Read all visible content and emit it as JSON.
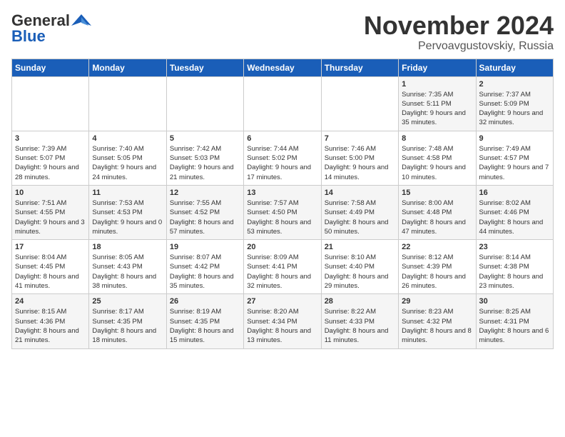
{
  "logo": {
    "general": "General",
    "blue": "Blue"
  },
  "title": "November 2024",
  "location": "Pervoavgustovskiy, Russia",
  "days_header": [
    "Sunday",
    "Monday",
    "Tuesday",
    "Wednesday",
    "Thursday",
    "Friday",
    "Saturday"
  ],
  "weeks": [
    [
      {
        "day": "",
        "detail": ""
      },
      {
        "day": "",
        "detail": ""
      },
      {
        "day": "",
        "detail": ""
      },
      {
        "day": "",
        "detail": ""
      },
      {
        "day": "",
        "detail": ""
      },
      {
        "day": "1",
        "detail": "Sunrise: 7:35 AM\nSunset: 5:11 PM\nDaylight: 9 hours and 35 minutes."
      },
      {
        "day": "2",
        "detail": "Sunrise: 7:37 AM\nSunset: 5:09 PM\nDaylight: 9 hours and 32 minutes."
      }
    ],
    [
      {
        "day": "3",
        "detail": "Sunrise: 7:39 AM\nSunset: 5:07 PM\nDaylight: 9 hours and 28 minutes."
      },
      {
        "day": "4",
        "detail": "Sunrise: 7:40 AM\nSunset: 5:05 PM\nDaylight: 9 hours and 24 minutes."
      },
      {
        "day": "5",
        "detail": "Sunrise: 7:42 AM\nSunset: 5:03 PM\nDaylight: 9 hours and 21 minutes."
      },
      {
        "day": "6",
        "detail": "Sunrise: 7:44 AM\nSunset: 5:02 PM\nDaylight: 9 hours and 17 minutes."
      },
      {
        "day": "7",
        "detail": "Sunrise: 7:46 AM\nSunset: 5:00 PM\nDaylight: 9 hours and 14 minutes."
      },
      {
        "day": "8",
        "detail": "Sunrise: 7:48 AM\nSunset: 4:58 PM\nDaylight: 9 hours and 10 minutes."
      },
      {
        "day": "9",
        "detail": "Sunrise: 7:49 AM\nSunset: 4:57 PM\nDaylight: 9 hours and 7 minutes."
      }
    ],
    [
      {
        "day": "10",
        "detail": "Sunrise: 7:51 AM\nSunset: 4:55 PM\nDaylight: 9 hours and 3 minutes."
      },
      {
        "day": "11",
        "detail": "Sunrise: 7:53 AM\nSunset: 4:53 PM\nDaylight: 9 hours and 0 minutes."
      },
      {
        "day": "12",
        "detail": "Sunrise: 7:55 AM\nSunset: 4:52 PM\nDaylight: 8 hours and 57 minutes."
      },
      {
        "day": "13",
        "detail": "Sunrise: 7:57 AM\nSunset: 4:50 PM\nDaylight: 8 hours and 53 minutes."
      },
      {
        "day": "14",
        "detail": "Sunrise: 7:58 AM\nSunset: 4:49 PM\nDaylight: 8 hours and 50 minutes."
      },
      {
        "day": "15",
        "detail": "Sunrise: 8:00 AM\nSunset: 4:48 PM\nDaylight: 8 hours and 47 minutes."
      },
      {
        "day": "16",
        "detail": "Sunrise: 8:02 AM\nSunset: 4:46 PM\nDaylight: 8 hours and 44 minutes."
      }
    ],
    [
      {
        "day": "17",
        "detail": "Sunrise: 8:04 AM\nSunset: 4:45 PM\nDaylight: 8 hours and 41 minutes."
      },
      {
        "day": "18",
        "detail": "Sunrise: 8:05 AM\nSunset: 4:43 PM\nDaylight: 8 hours and 38 minutes."
      },
      {
        "day": "19",
        "detail": "Sunrise: 8:07 AM\nSunset: 4:42 PM\nDaylight: 8 hours and 35 minutes."
      },
      {
        "day": "20",
        "detail": "Sunrise: 8:09 AM\nSunset: 4:41 PM\nDaylight: 8 hours and 32 minutes."
      },
      {
        "day": "21",
        "detail": "Sunrise: 8:10 AM\nSunset: 4:40 PM\nDaylight: 8 hours and 29 minutes."
      },
      {
        "day": "22",
        "detail": "Sunrise: 8:12 AM\nSunset: 4:39 PM\nDaylight: 8 hours and 26 minutes."
      },
      {
        "day": "23",
        "detail": "Sunrise: 8:14 AM\nSunset: 4:38 PM\nDaylight: 8 hours and 23 minutes."
      }
    ],
    [
      {
        "day": "24",
        "detail": "Sunrise: 8:15 AM\nSunset: 4:36 PM\nDaylight: 8 hours and 21 minutes."
      },
      {
        "day": "25",
        "detail": "Sunrise: 8:17 AM\nSunset: 4:35 PM\nDaylight: 8 hours and 18 minutes."
      },
      {
        "day": "26",
        "detail": "Sunrise: 8:19 AM\nSunset: 4:35 PM\nDaylight: 8 hours and 15 minutes."
      },
      {
        "day": "27",
        "detail": "Sunrise: 8:20 AM\nSunset: 4:34 PM\nDaylight: 8 hours and 13 minutes."
      },
      {
        "day": "28",
        "detail": "Sunrise: 8:22 AM\nSunset: 4:33 PM\nDaylight: 8 hours and 11 minutes."
      },
      {
        "day": "29",
        "detail": "Sunrise: 8:23 AM\nSunset: 4:32 PM\nDaylight: 8 hours and 8 minutes."
      },
      {
        "day": "30",
        "detail": "Sunrise: 8:25 AM\nSunset: 4:31 PM\nDaylight: 8 hours and 6 minutes."
      }
    ]
  ]
}
